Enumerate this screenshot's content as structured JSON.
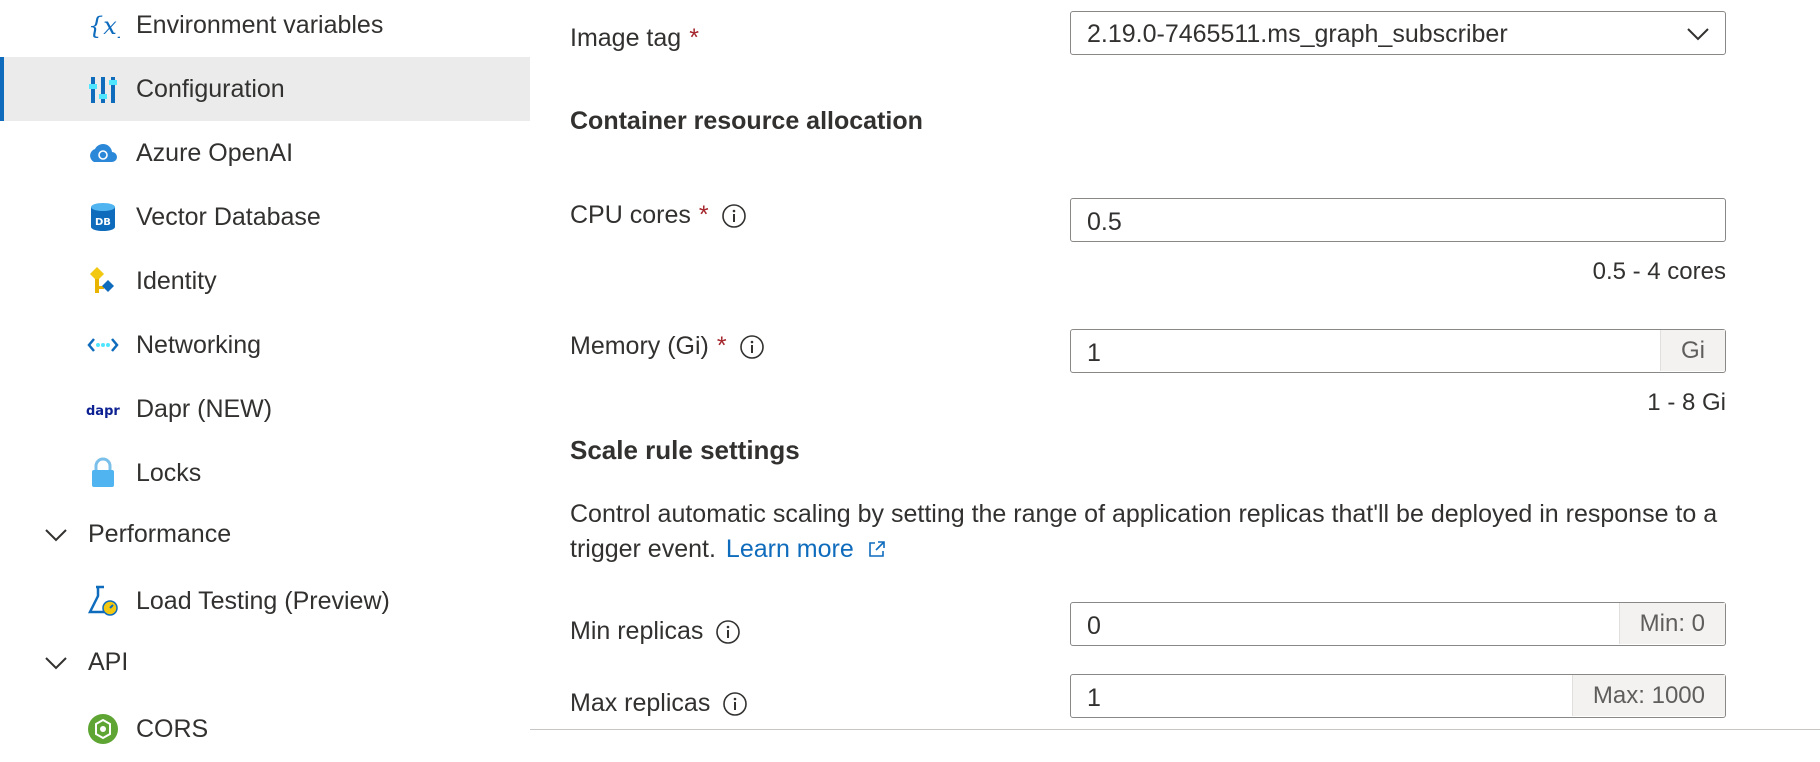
{
  "sidebar": {
    "items": [
      {
        "label": "Environment variables",
        "icon": "variable-icon"
      },
      {
        "label": "Configuration",
        "icon": "configuration-icon",
        "active": true
      },
      {
        "label": "Azure OpenAI",
        "icon": "azure-openai-icon"
      },
      {
        "label": "Vector Database",
        "icon": "database-icon"
      },
      {
        "label": "Identity",
        "icon": "key-icon"
      },
      {
        "label": "Networking",
        "icon": "networking-icon"
      },
      {
        "label": "Dapr (NEW)",
        "icon": "dapr-icon"
      },
      {
        "label": "Locks",
        "icon": "lock-icon"
      }
    ],
    "performance": {
      "label": "Performance",
      "items": [
        {
          "label": "Load Testing (Preview)",
          "icon": "load-testing-icon"
        }
      ]
    },
    "api": {
      "label": "API",
      "items": [
        {
          "label": "CORS",
          "icon": "cors-icon"
        }
      ]
    }
  },
  "form": {
    "image_tag": {
      "label": "Image tag",
      "required": "*",
      "value": "2.19.0-7465511.ms_graph_subscriber"
    },
    "resource_section": "Container resource allocation",
    "cpu": {
      "label": "CPU cores",
      "required": "*",
      "value": "0.5",
      "hint": "0.5 - 4 cores"
    },
    "memory": {
      "label": "Memory (Gi)",
      "required": "*",
      "value": "1",
      "suffix": "Gi",
      "hint": "1 - 8 Gi"
    },
    "scale_section": "Scale rule settings",
    "scale_description": "Control automatic scaling by setting the range of application replicas that'll be deployed in response to a trigger event.",
    "learn_more": "Learn more",
    "min_replicas": {
      "label": "Min replicas",
      "value": "0",
      "suffix": "Min: 0"
    },
    "max_replicas": {
      "label": "Max replicas",
      "value": "1",
      "suffix": "Max: 1000"
    }
  },
  "colors": {
    "accent": "#0f6cbd",
    "required": "#a4262c",
    "active_bg": "#ebebeb"
  }
}
